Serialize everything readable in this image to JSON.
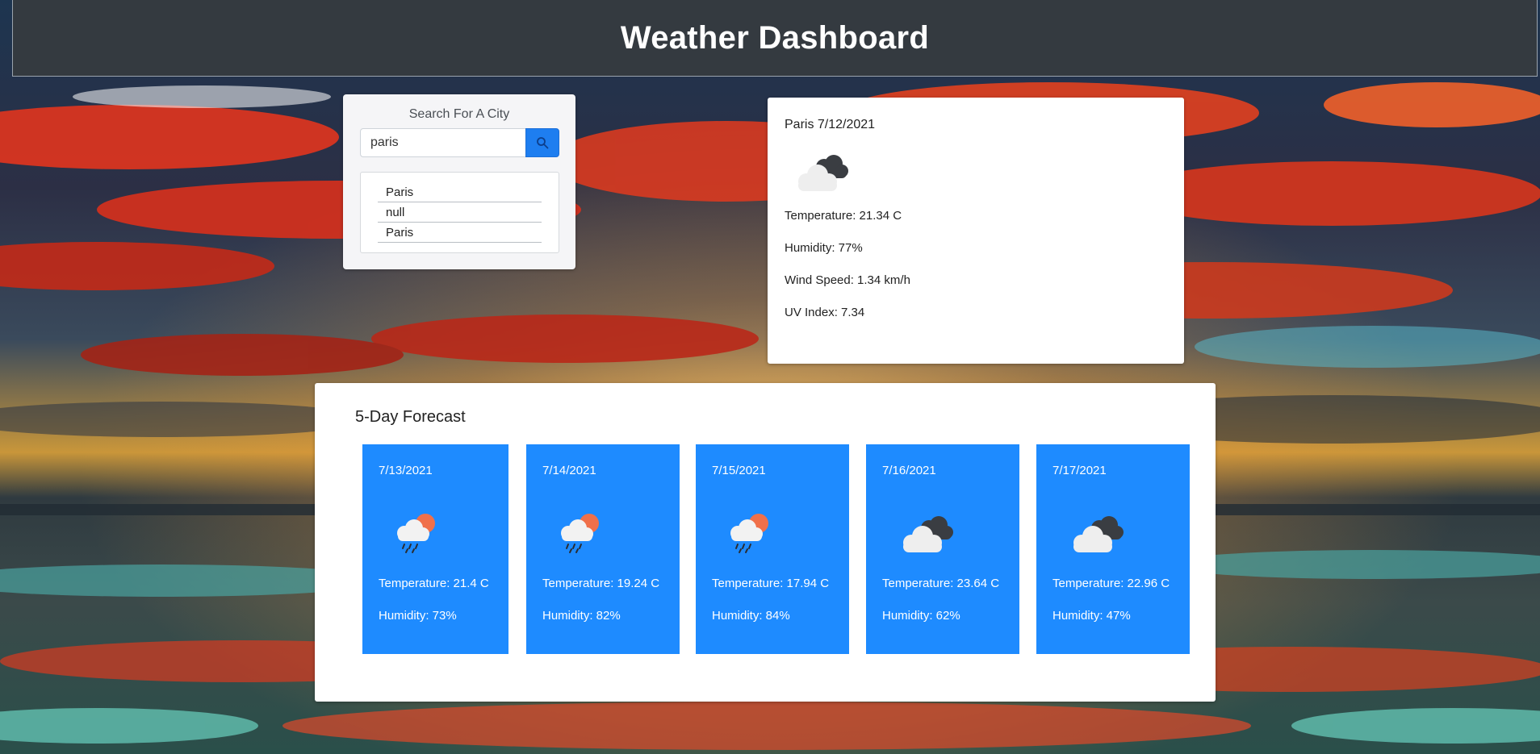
{
  "header": {
    "title": "Weather Dashboard"
  },
  "search": {
    "title": "Search For A City",
    "input_value": "paris",
    "button_icon": "search-icon",
    "history": [
      "Paris",
      "null",
      "Paris"
    ]
  },
  "current": {
    "title": "Paris 7/12/2021",
    "icon": "broken-clouds-icon",
    "temperature": "Temperature: 21.34 C",
    "humidity": "Humidity: 77%",
    "wind": "Wind Speed: 1.34 km/h",
    "uv": "UV Index: 7.34"
  },
  "forecast": {
    "title": "5-Day Forecast",
    "days": [
      {
        "date": "7/13/2021",
        "icon": "rain-sun-icon",
        "temperature": "Temperature: 21.4 C",
        "humidity": "Humidity: 73%"
      },
      {
        "date": "7/14/2021",
        "icon": "rain-sun-icon",
        "temperature": "Temperature: 19.24 C",
        "humidity": "Humidity: 82%"
      },
      {
        "date": "7/15/2021",
        "icon": "rain-sun-icon",
        "temperature": "Temperature: 17.94 C",
        "humidity": "Humidity: 84%"
      },
      {
        "date": "7/16/2021",
        "icon": "broken-clouds-icon",
        "temperature": "Temperature: 23.64 C",
        "humidity": "Humidity: 62%"
      },
      {
        "date": "7/17/2021",
        "icon": "broken-clouds-icon",
        "temperature": "Temperature: 22.96 C",
        "humidity": "Humidity: 47%"
      }
    ]
  },
  "colors": {
    "header_bg": "#343a40",
    "accent_blue": "#1e8bff",
    "search_button": "#1e7ef0"
  }
}
